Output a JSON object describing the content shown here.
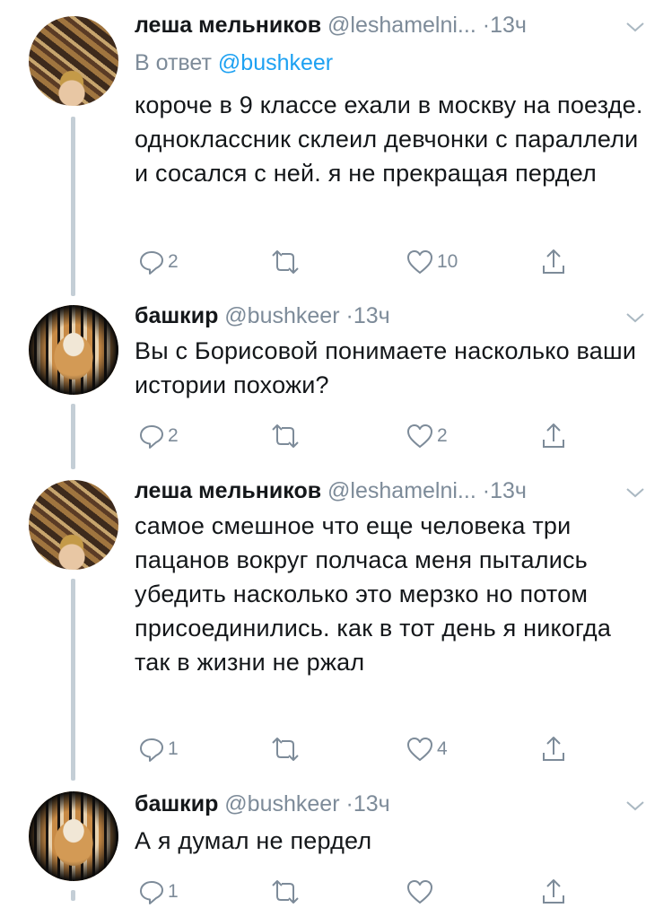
{
  "tweets": [
    {
      "name": "леша мельников",
      "handle": "@leshamelni...",
      "time": "13ч",
      "reply_prefix": "В ответ",
      "reply_handle": "@bushkeer",
      "text": "короче в 9 классе ехали в москву на поезде. одноклассник склеил девчонки с параллели и сосался с ней. я не прекращая пердел",
      "replies": "2",
      "retweets": "",
      "likes": "10"
    },
    {
      "name": "башкир",
      "handle": "@bushkeer",
      "time": "13ч",
      "text": "Вы с Борисовой понимаете насколько ваши истории похожи?",
      "replies": "2",
      "retweets": "",
      "likes": "2"
    },
    {
      "name": "леша мельников",
      "handle": "@leshamelni...",
      "time": "13ч",
      "text": "самое смешное что еще человека три пацанов вокруг полчаса меня пытались убедить насколько это мерзко но потом присоединились. как в тот день я никогда так в жизни не ржал",
      "replies": "1",
      "retweets": "",
      "likes": "4"
    },
    {
      "name": "башкир",
      "handle": "@bushkeer",
      "time": "13ч",
      "text": "А я думал не пердел",
      "replies": "1",
      "retweets": "",
      "likes": ""
    }
  ],
  "separator": "·",
  "colors": {
    "accent": "#1da1f2",
    "muted": "#7d8b99",
    "thread_line": "#c4ced6",
    "text": "#14171a"
  },
  "icons": [
    "reply-icon",
    "retweet-icon",
    "like-icon",
    "share-icon",
    "chevron-down-icon"
  ]
}
